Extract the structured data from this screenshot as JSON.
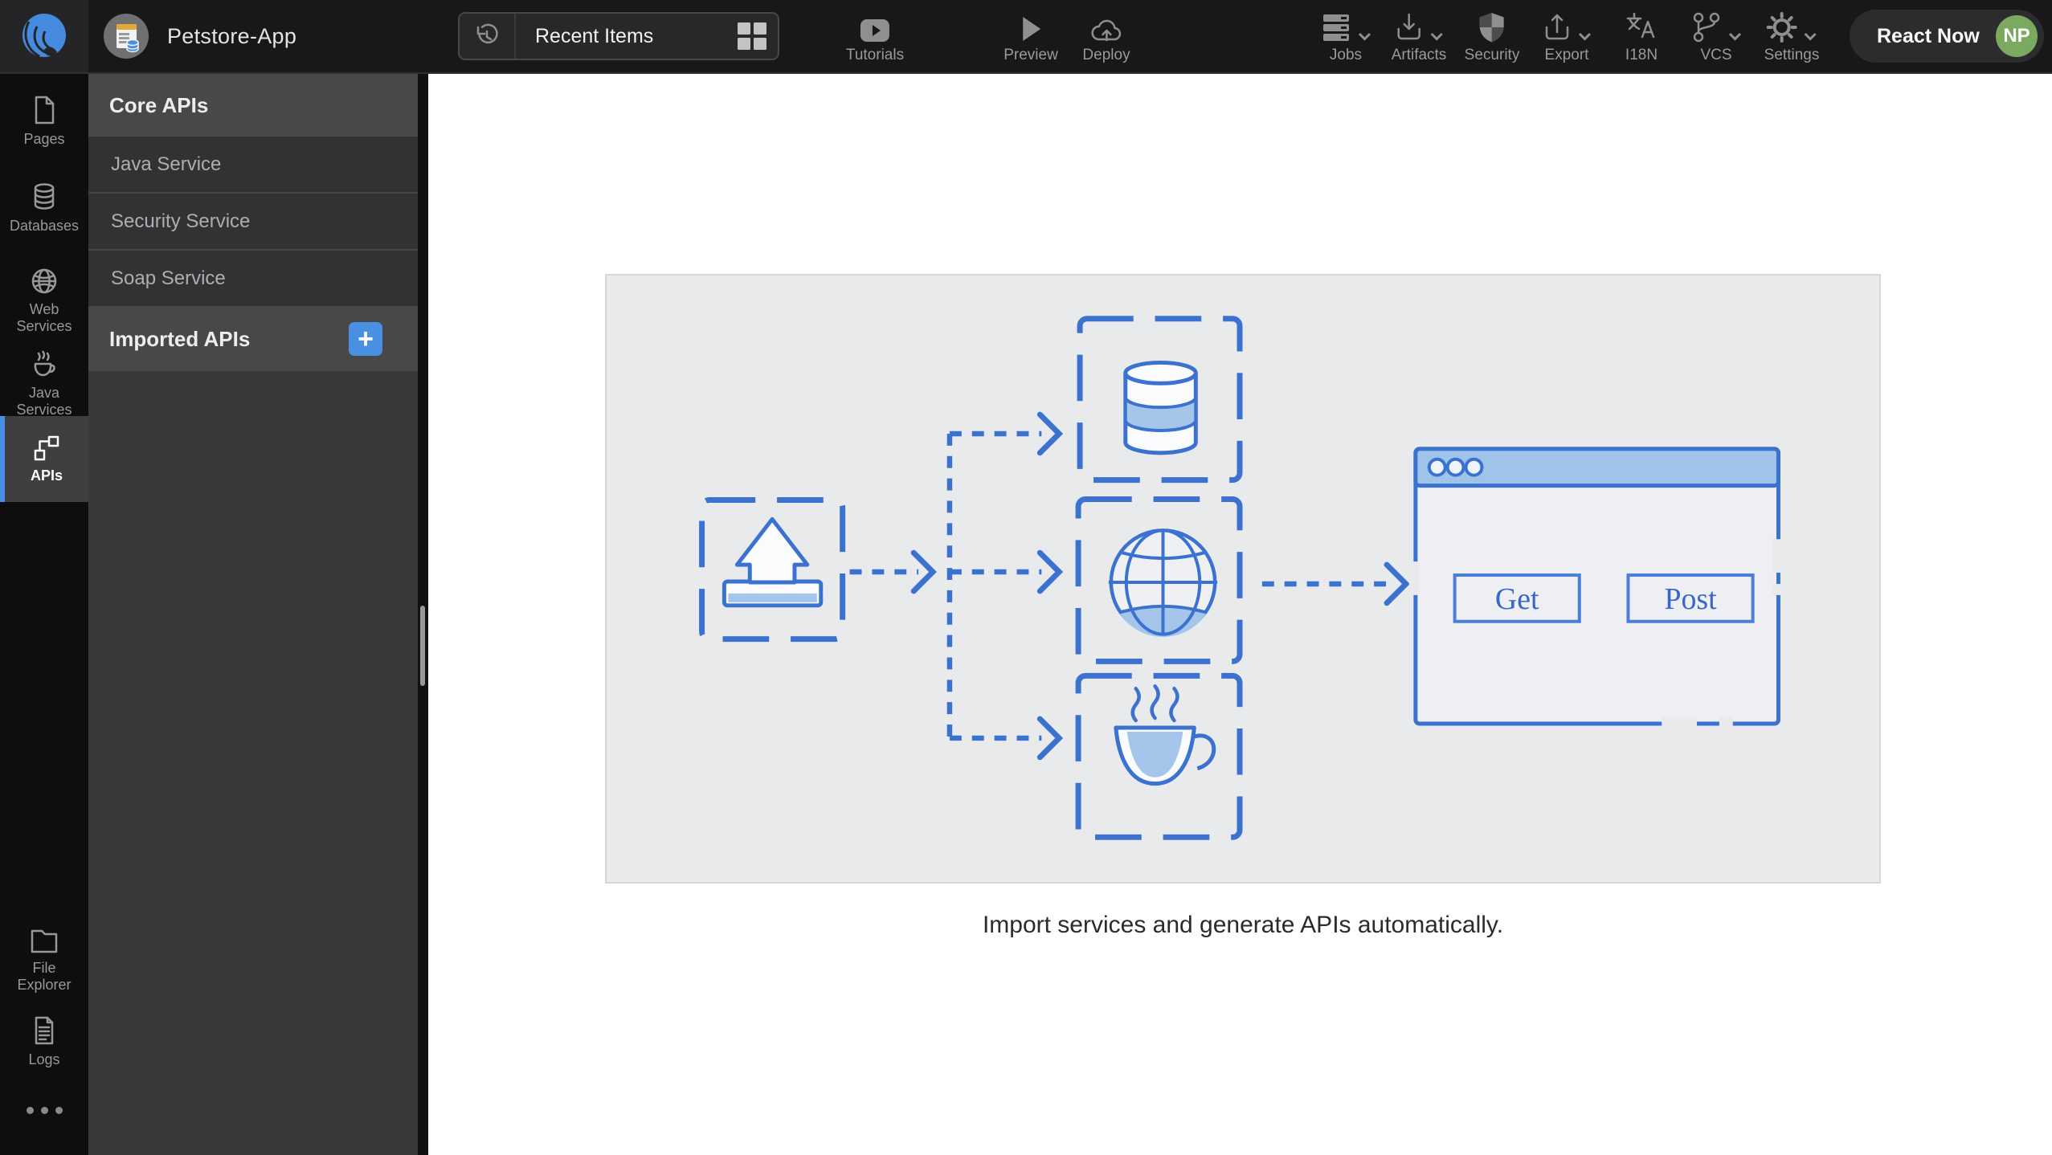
{
  "topbar": {
    "app_title": "Petstore-App",
    "recent_items_label": "Recent Items",
    "actions": [
      {
        "label": "Tutorials"
      },
      {
        "label": "Preview"
      },
      {
        "label": "Deploy"
      }
    ],
    "menus": [
      {
        "label": "Jobs",
        "chevron": true
      },
      {
        "label": "Artifacts",
        "chevron": true
      },
      {
        "label": "Security",
        "chevron": false
      },
      {
        "label": "Export",
        "chevron": true
      },
      {
        "label": "I18N",
        "chevron": false
      },
      {
        "label": "VCS",
        "chevron": true
      },
      {
        "label": "Settings",
        "chevron": true
      }
    ],
    "react_now_label": "React Now",
    "avatar_initials": "NP"
  },
  "sidebar": {
    "items": [
      {
        "label": "Pages"
      },
      {
        "label": "Databases"
      },
      {
        "label": "Web Services"
      },
      {
        "label": "Java Services"
      },
      {
        "label": "APIs",
        "active": true
      },
      {
        "label": "File Explorer"
      },
      {
        "label": "Logs"
      }
    ]
  },
  "panel": {
    "core_header": "Core APIs",
    "core_items": [
      "Java Service",
      "Security Service",
      "Soap Service"
    ],
    "imported_header": "Imported APIs",
    "add_button_label": "+"
  },
  "main": {
    "caption": "Import services and generate APIs automatically.",
    "diagram": {
      "get_label": "Get",
      "post_label": "Post"
    }
  },
  "colors": {
    "accent_blue": "#3b72d0",
    "light_blue": "#a5c6ea",
    "plus_blue": "#4a90e2",
    "avatar_green": "#7aa95f",
    "diagram_bg": "#e9eaec"
  }
}
